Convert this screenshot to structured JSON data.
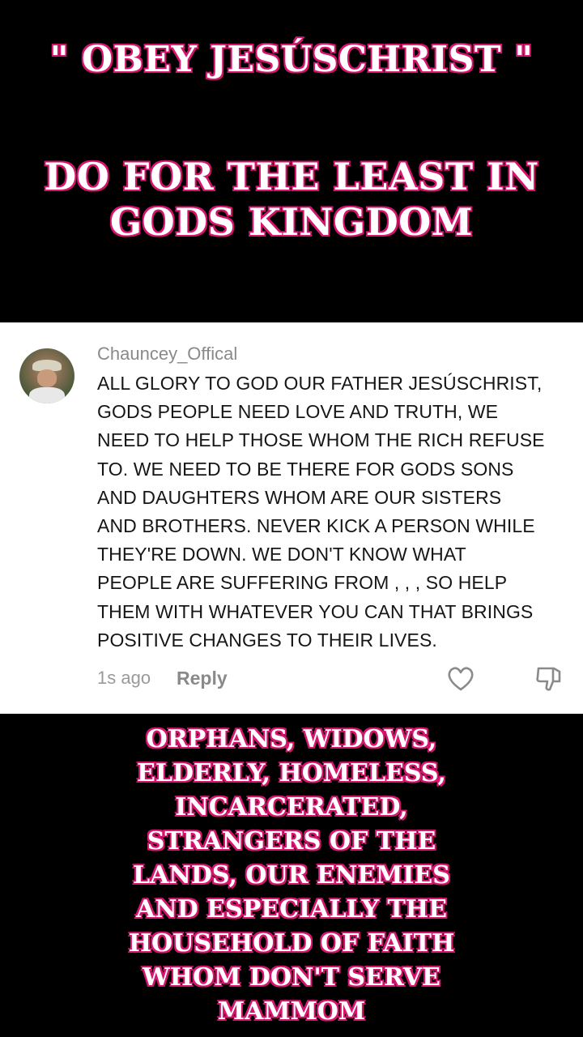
{
  "overlay_top": {
    "title": "\" OBEY JESÚSCHRIST \"",
    "subtitle": "DO FOR THE LEAST IN GODS KINGDOM"
  },
  "comment": {
    "username": "Chauncey_Offical",
    "text_lines": [
      "ALL GLORY TO GOD OUR FATHER JESÚSCHRIST,",
      "GODS PEOPLE NEED LOVE AND TRUTH, WE",
      "NEED TO HELP THOSE WHOM THE RICH REFUSE",
      "TO. WE NEED TO BE THERE FOR GODS SONS",
      "AND DAUGHTERS WHOM ARE OUR SISTERS",
      "AND BROTHERS. NEVER KICK A PERSON WHILE",
      "THEY'RE DOWN. WE DON'T KNOW WHAT",
      "PEOPLE ARE SUFFERING FROM , , , SO HELP",
      "THEM WITH WHATEVER YOU CAN THAT BRINGS",
      "POSITIVE CHANGES TO THEIR LIVES."
    ],
    "timestamp": "1s ago",
    "reply_label": "Reply",
    "like_icon": "heart-outline-icon",
    "dislike_icon": "thumbs-down-outline-icon"
  },
  "overlay_bottom": {
    "lines": [
      "ORPHANS, WIDOWS,",
      "ELDERLY, HOMELESS,",
      "INCARCERATED,",
      "STRANGERS OF THE",
      "LANDS, OUR ENEMIES",
      "AND ESPECIALLY THE",
      "HOUSEHOLD OF FAITH",
      "WHOM DON'T SERVE",
      "MAMMOM"
    ]
  },
  "colors": {
    "background": "#000000",
    "card": "#ffffff",
    "accent_stroke": "#d6156f",
    "comment_text": "#161616",
    "muted_text": "#8a8a8a"
  }
}
